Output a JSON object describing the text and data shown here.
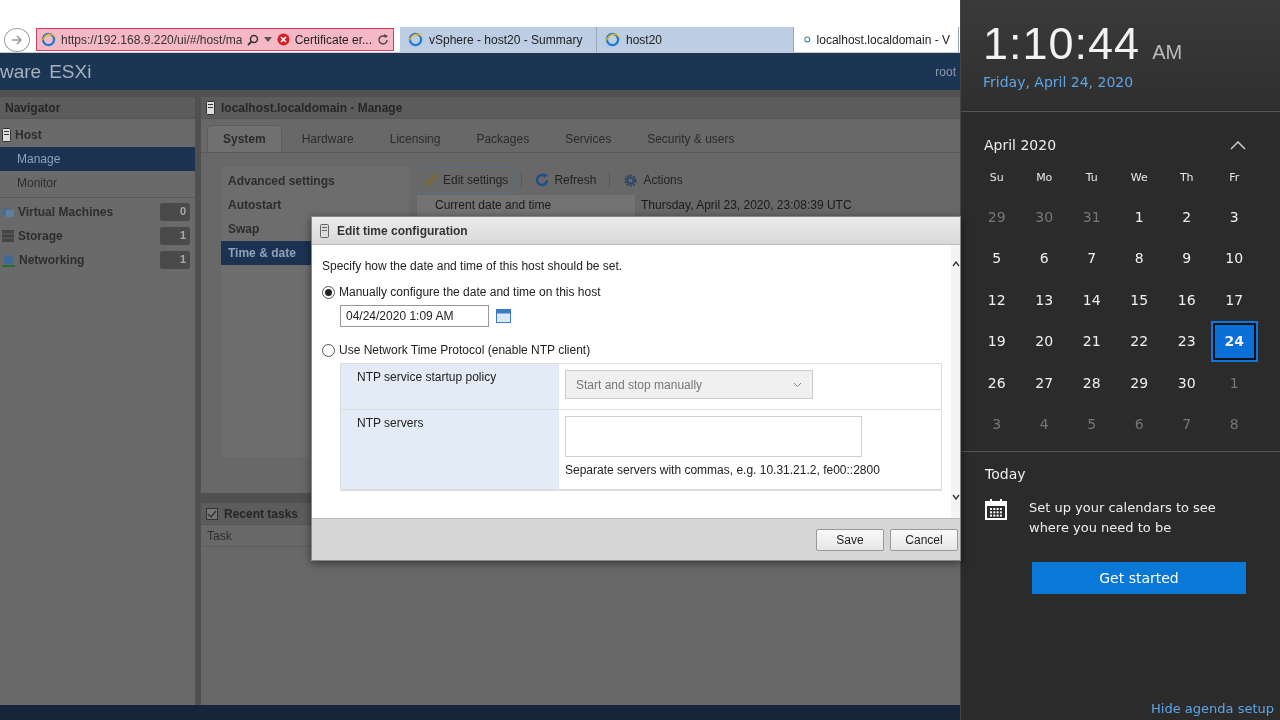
{
  "browser": {
    "address": "https://192.168.9.220/ui/#/host/ma",
    "cert_error": "Certificate er...",
    "tabs": [
      {
        "label": "vSphere - host20 - Summary",
        "selected": false
      },
      {
        "label": "host20",
        "selected": false
      },
      {
        "label": "localhost.localdomain - V",
        "selected": true
      }
    ]
  },
  "header": {
    "logo_left": "ware",
    "logo_right": "ESXi",
    "user": "root"
  },
  "navigator": {
    "title": "Navigator",
    "items": [
      {
        "label": "Host",
        "kind": "host",
        "selected": false
      },
      {
        "label": "Manage",
        "kind": "child",
        "selected": true
      },
      {
        "label": "Monitor",
        "kind": "child",
        "selected": false
      },
      {
        "label": "Virtual Machines",
        "kind": "vms",
        "count": "0",
        "selected": false
      },
      {
        "label": "Storage",
        "kind": "storage",
        "count": "1",
        "selected": false
      },
      {
        "label": "Networking",
        "kind": "network",
        "count": "1",
        "selected": false
      }
    ]
  },
  "manage": {
    "title": "localhost.localdomain - Manage",
    "tabs": [
      {
        "label": "System",
        "selected": true
      },
      {
        "label": "Hardware",
        "selected": false
      },
      {
        "label": "Licensing",
        "selected": false
      },
      {
        "label": "Packages",
        "selected": false
      },
      {
        "label": "Services",
        "selected": false
      },
      {
        "label": "Security & users",
        "selected": false
      }
    ],
    "sections": [
      {
        "label": "Advanced settings",
        "selected": false
      },
      {
        "label": "Autostart",
        "selected": false
      },
      {
        "label": "Swap",
        "selected": false
      },
      {
        "label": "Time & date",
        "selected": true
      }
    ],
    "toolbar": [
      {
        "label": "Edit settings",
        "kind": "edit",
        "focused": true
      },
      {
        "label": "Refresh",
        "kind": "refresh",
        "focused": false
      },
      {
        "label": "Actions",
        "kind": "actions",
        "focused": false
      }
    ],
    "rows": [
      {
        "label": "Current date and time",
        "value": "Thursday, April 23, 2020, 23:08:39 UTC"
      }
    ]
  },
  "recent_tasks": {
    "title": "Recent tasks",
    "columns": [
      "Task"
    ]
  },
  "dialog": {
    "title": "Edit time configuration",
    "description": "Specify how the date and time of this host should be set.",
    "options": [
      {
        "label": "Manually configure the date and time on this host",
        "selected": true
      },
      {
        "label": "Use Network Time Protocol (enable NTP client)",
        "selected": false
      }
    ],
    "datetime": "04/24/2020 1:09 AM",
    "ntp": {
      "disabled": true,
      "policy_label": "NTP service startup policy",
      "policy_value": "Start and stop manually",
      "servers_label": "NTP servers",
      "servers_hint": "Separate servers with commas, e.g. 10.31.21.2, fe00::2800"
    },
    "buttons": [
      "Save",
      "Cancel"
    ]
  },
  "clock": {
    "time": "1:10:44",
    "ampm": "AM",
    "date": "Friday, April 24, 2020",
    "month": "April 2020",
    "weekdays": [
      "Su",
      "Mo",
      "Tu",
      "We",
      "Th",
      "Fr"
    ],
    "weeks": [
      [
        {
          "label": "29",
          "other_month": true,
          "selected": false
        },
        {
          "label": "30",
          "other_month": true,
          "selected": false
        },
        {
          "label": "31",
          "other_month": true,
          "selected": false
        },
        {
          "label": "1",
          "other_month": false,
          "selected": false
        },
        {
          "label": "2",
          "other_month": false,
          "selected": false
        },
        {
          "label": "3",
          "other_month": false,
          "selected": false
        }
      ],
      [
        {
          "label": "5",
          "other_month": false,
          "selected": false
        },
        {
          "label": "6",
          "other_month": false,
          "selected": false
        },
        {
          "label": "7",
          "other_month": false,
          "selected": false
        },
        {
          "label": "8",
          "other_month": false,
          "selected": false
        },
        {
          "label": "9",
          "other_month": false,
          "selected": false
        },
        {
          "label": "10",
          "other_month": false,
          "selected": false
        }
      ],
      [
        {
          "label": "12",
          "other_month": false,
          "selected": false
        },
        {
          "label": "13",
          "other_month": false,
          "selected": false
        },
        {
          "label": "14",
          "other_month": false,
          "selected": false
        },
        {
          "label": "15",
          "other_month": false,
          "selected": false
        },
        {
          "label": "16",
          "other_month": false,
          "selected": false
        },
        {
          "label": "17",
          "other_month": false,
          "selected": false
        }
      ],
      [
        {
          "label": "19",
          "other_month": false,
          "selected": false
        },
        {
          "label": "20",
          "other_month": false,
          "selected": false
        },
        {
          "label": "21",
          "other_month": false,
          "selected": false
        },
        {
          "label": "22",
          "other_month": false,
          "selected": false
        },
        {
          "label": "23",
          "other_month": false,
          "selected": false
        },
        {
          "label": "24",
          "other_month": false,
          "selected": true
        }
      ],
      [
        {
          "label": "26",
          "other_month": false,
          "selected": false
        },
        {
          "label": "27",
          "other_month": false,
          "selected": false
        },
        {
          "label": "28",
          "other_month": false,
          "selected": false
        },
        {
          "label": "29",
          "other_month": false,
          "selected": false
        },
        {
          "label": "30",
          "other_month": false,
          "selected": false
        },
        {
          "label": "1",
          "other_month": true,
          "selected": false
        }
      ],
      [
        {
          "label": "3",
          "other_month": true,
          "selected": false
        },
        {
          "label": "4",
          "other_month": true,
          "selected": false
        },
        {
          "label": "5",
          "other_month": true,
          "selected": false
        },
        {
          "label": "6",
          "other_month": true,
          "selected": false
        },
        {
          "label": "7",
          "other_month": true,
          "selected": false
        },
        {
          "label": "8",
          "other_month": true,
          "selected": false
        }
      ]
    ],
    "agenda": {
      "title": "Today",
      "message": "Set up your calendars to see where you need to be",
      "button": "Get started",
      "link": "Hide agenda setup"
    }
  }
}
